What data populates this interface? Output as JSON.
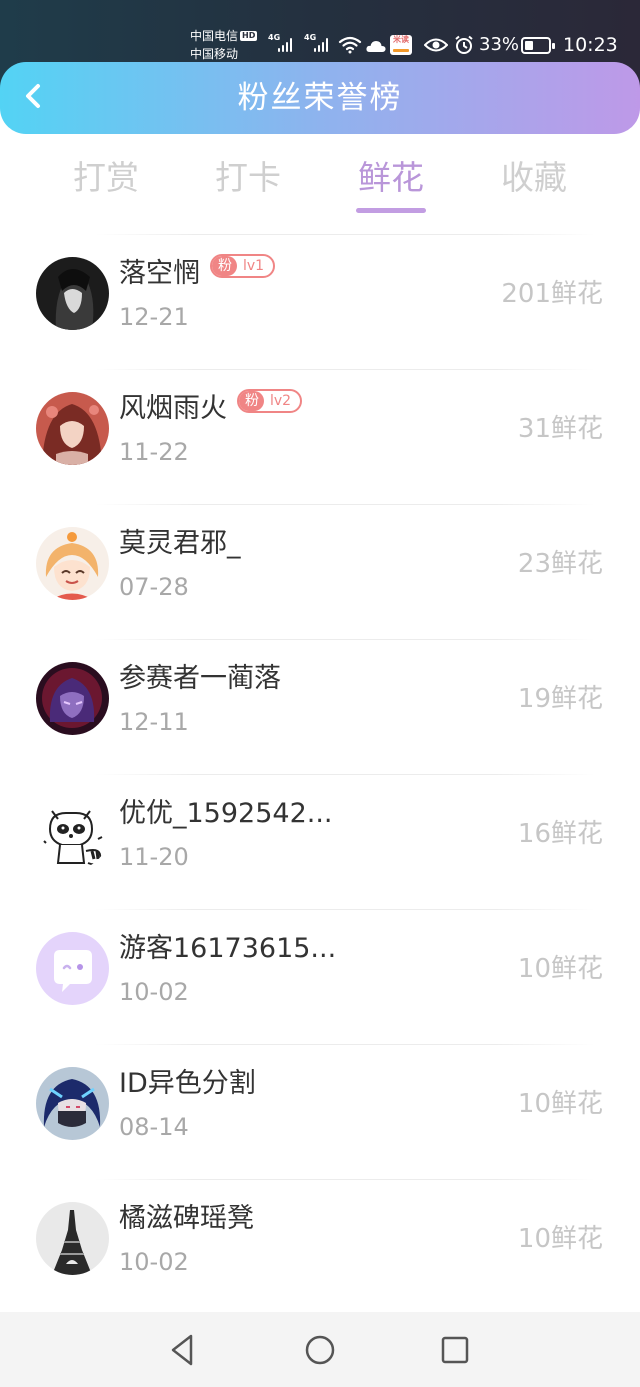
{
  "status_bar": {
    "carrier_1": "中国电信",
    "carrier_1_badge": "HD",
    "carrier_2": "中国移动",
    "network_1": "4G",
    "network_2": "4G",
    "app_icon_text": "米读",
    "battery_percent": "33%",
    "battery_level": 0.33,
    "time": "10:23",
    "icons": [
      "signal-icon",
      "wifi-icon",
      "cloud-icon",
      "eye-icon",
      "alarm-icon",
      "battery-icon"
    ]
  },
  "header": {
    "title": "粉丝荣誉榜",
    "back_icon": "chevron-left-icon"
  },
  "tabs": [
    {
      "label": "打赏",
      "active": false
    },
    {
      "label": "打卡",
      "active": false
    },
    {
      "label": "鲜花",
      "active": true
    },
    {
      "label": "收藏",
      "active": false
    }
  ],
  "list": [
    {
      "name": "落空惘",
      "badge": {
        "fan": "粉",
        "level": "lv1"
      },
      "date": "12-21",
      "amount": "201鲜花",
      "avatar": "dark-anime-avatar"
    },
    {
      "name": "风烟雨火",
      "badge": {
        "fan": "粉",
        "level": "lv2"
      },
      "date": "11-22",
      "amount": "31鲜花",
      "avatar": "red-anime-avatar"
    },
    {
      "name": "莫灵君邪_",
      "date": "07-28",
      "amount": "23鲜花",
      "avatar": "orange-anime-avatar"
    },
    {
      "name": "参赛者一蔺落",
      "date": "12-11",
      "amount": "19鲜花",
      "avatar": "purple-anime-avatar"
    },
    {
      "name": "优优_1592542...",
      "date": "11-20",
      "amount": "16鲜花",
      "avatar": "raccoon-sketch-avatar"
    },
    {
      "name": "游客16173615...",
      "date": "10-02",
      "amount": "10鲜花",
      "avatar": "default-chat-avatar"
    },
    {
      "name": "ID异色分割",
      "date": "08-14",
      "amount": "10鲜花",
      "avatar": "blue-anime-avatar"
    },
    {
      "name": "橘滋碑瑶凳",
      "date": "10-02",
      "amount": "10鲜花",
      "avatar": "eiffel-tower-avatar"
    }
  ],
  "nav_bar": {
    "back": "triangle-back-icon",
    "home": "circle-home-icon",
    "recents": "square-recents-icon"
  }
}
